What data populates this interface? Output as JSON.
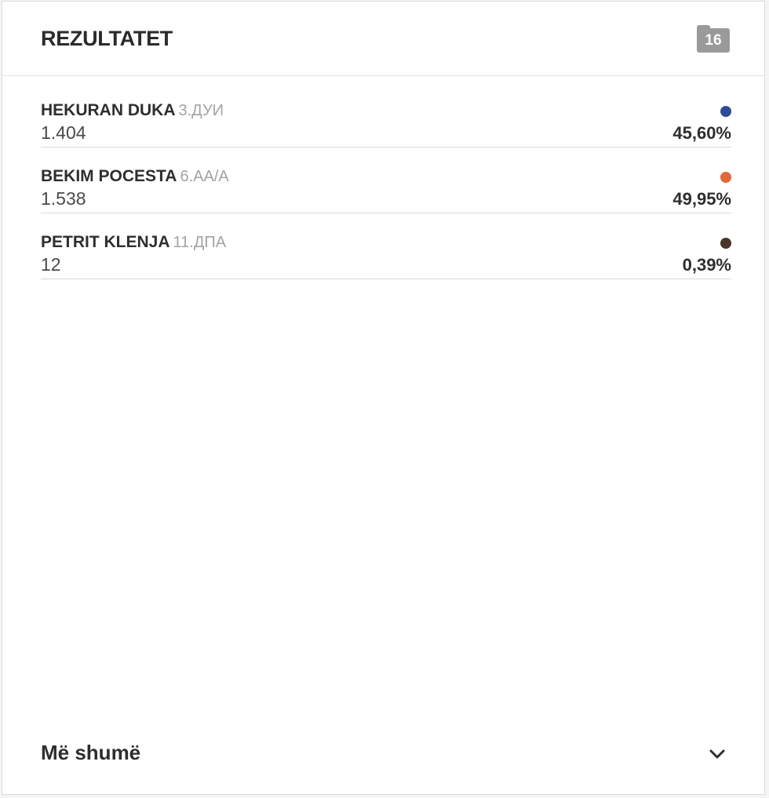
{
  "header": {
    "title": "REZULTATET",
    "badge_icon": "folder-icon",
    "badge_count": "16"
  },
  "results": [
    {
      "name": "HEKURAN DUKA",
      "party": "3.ДУИ",
      "votes": "1.404",
      "percent": "45,60%",
      "color": "#2f4b96"
    },
    {
      "name": "BEKIM POCESTA",
      "party": "6.АА/А",
      "votes": "1.538",
      "percent": "49,95%",
      "color": "#e0683a"
    },
    {
      "name": "PETRIT KLENJA",
      "party": "11.ДПА",
      "votes": "12",
      "percent": "0,39%",
      "color": "#4a3327"
    }
  ],
  "footer": {
    "more_label": "Më shumë",
    "expand_icon": "chevron-down-icon"
  }
}
